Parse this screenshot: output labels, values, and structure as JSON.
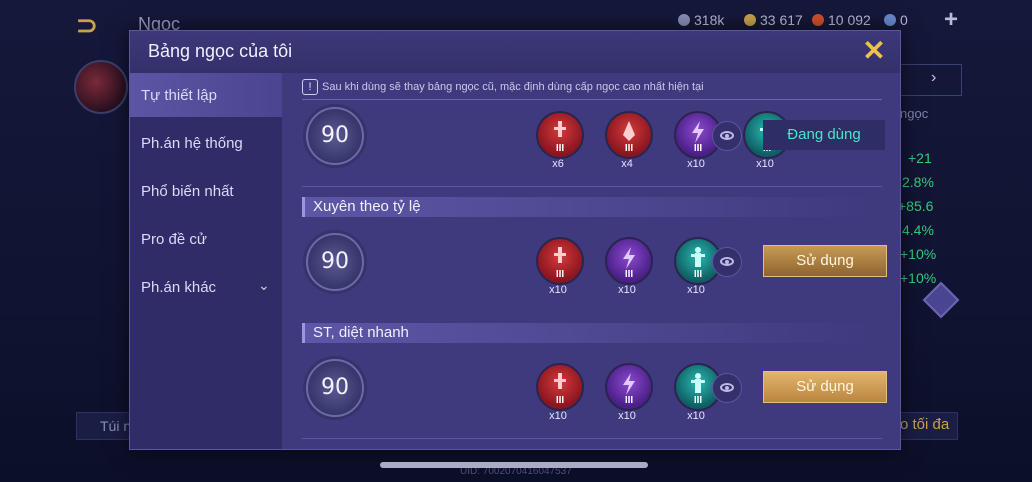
{
  "background": {
    "title": "Ngọc",
    "resources": [
      {
        "value": "318k",
        "color": "#8a8fb8"
      },
      {
        "value": "33 617",
        "color": "#c9a24a"
      },
      {
        "value": "10 092",
        "color": "#d2502a"
      },
      {
        "value": "0",
        "color": "#6a8ad0"
      }
    ],
    "stats": [
      "+21",
      "2.8%",
      "+85.6",
      "4.4%",
      "+10%",
      "+10%"
    ],
    "ngoc_label": "ngọc",
    "bottom_left": "Túi n",
    "bottom_right": "o tối đa",
    "uid": "UID: 7002070416047537"
  },
  "modal": {
    "title": "Bảng ngọc của tôi",
    "close_label": "✕",
    "sidebar": [
      {
        "label": "Tự thiết lập",
        "active": true
      },
      {
        "label": "Ph.án hệ thống",
        "active": false
      },
      {
        "label": "Phổ biến nhất",
        "active": false
      },
      {
        "label": "Pro đề cử",
        "active": false
      },
      {
        "label": "Ph.án khác",
        "active": false,
        "chevron": "⌄"
      }
    ],
    "notice": "Sau khi dùng sẽ thay bảng ngọc cũ, mặc định dùng cấp ngọc cao nhất hiện tại",
    "pages": [
      {
        "title": "",
        "level": "90",
        "runes": [
          {
            "color": "red",
            "tier": "III",
            "count": "x6"
          },
          {
            "color": "red",
            "tier": "III",
            "count": "x4"
          },
          {
            "color": "purple",
            "tier": "III",
            "count": "x10"
          },
          {
            "color": "teal",
            "tier": "III",
            "count": "x10"
          }
        ],
        "button": "Đang dùng"
      },
      {
        "title": "Xuyên theo tỷ lệ",
        "level": "90",
        "runes": [
          {
            "color": "red",
            "tier": "III",
            "count": "x10"
          },
          {
            "color": "purple",
            "tier": "III",
            "count": "x10"
          },
          {
            "color": "teal",
            "tier": "III",
            "count": "x10"
          }
        ],
        "button": "Sử dụng"
      },
      {
        "title": "ST, diệt nhanh",
        "level": "90",
        "runes": [
          {
            "color": "red",
            "tier": "III",
            "count": "x10"
          },
          {
            "color": "purple",
            "tier": "III",
            "count": "x10"
          },
          {
            "color": "teal",
            "tier": "III",
            "count": "x10"
          }
        ],
        "button": "Sử dụng"
      }
    ]
  }
}
